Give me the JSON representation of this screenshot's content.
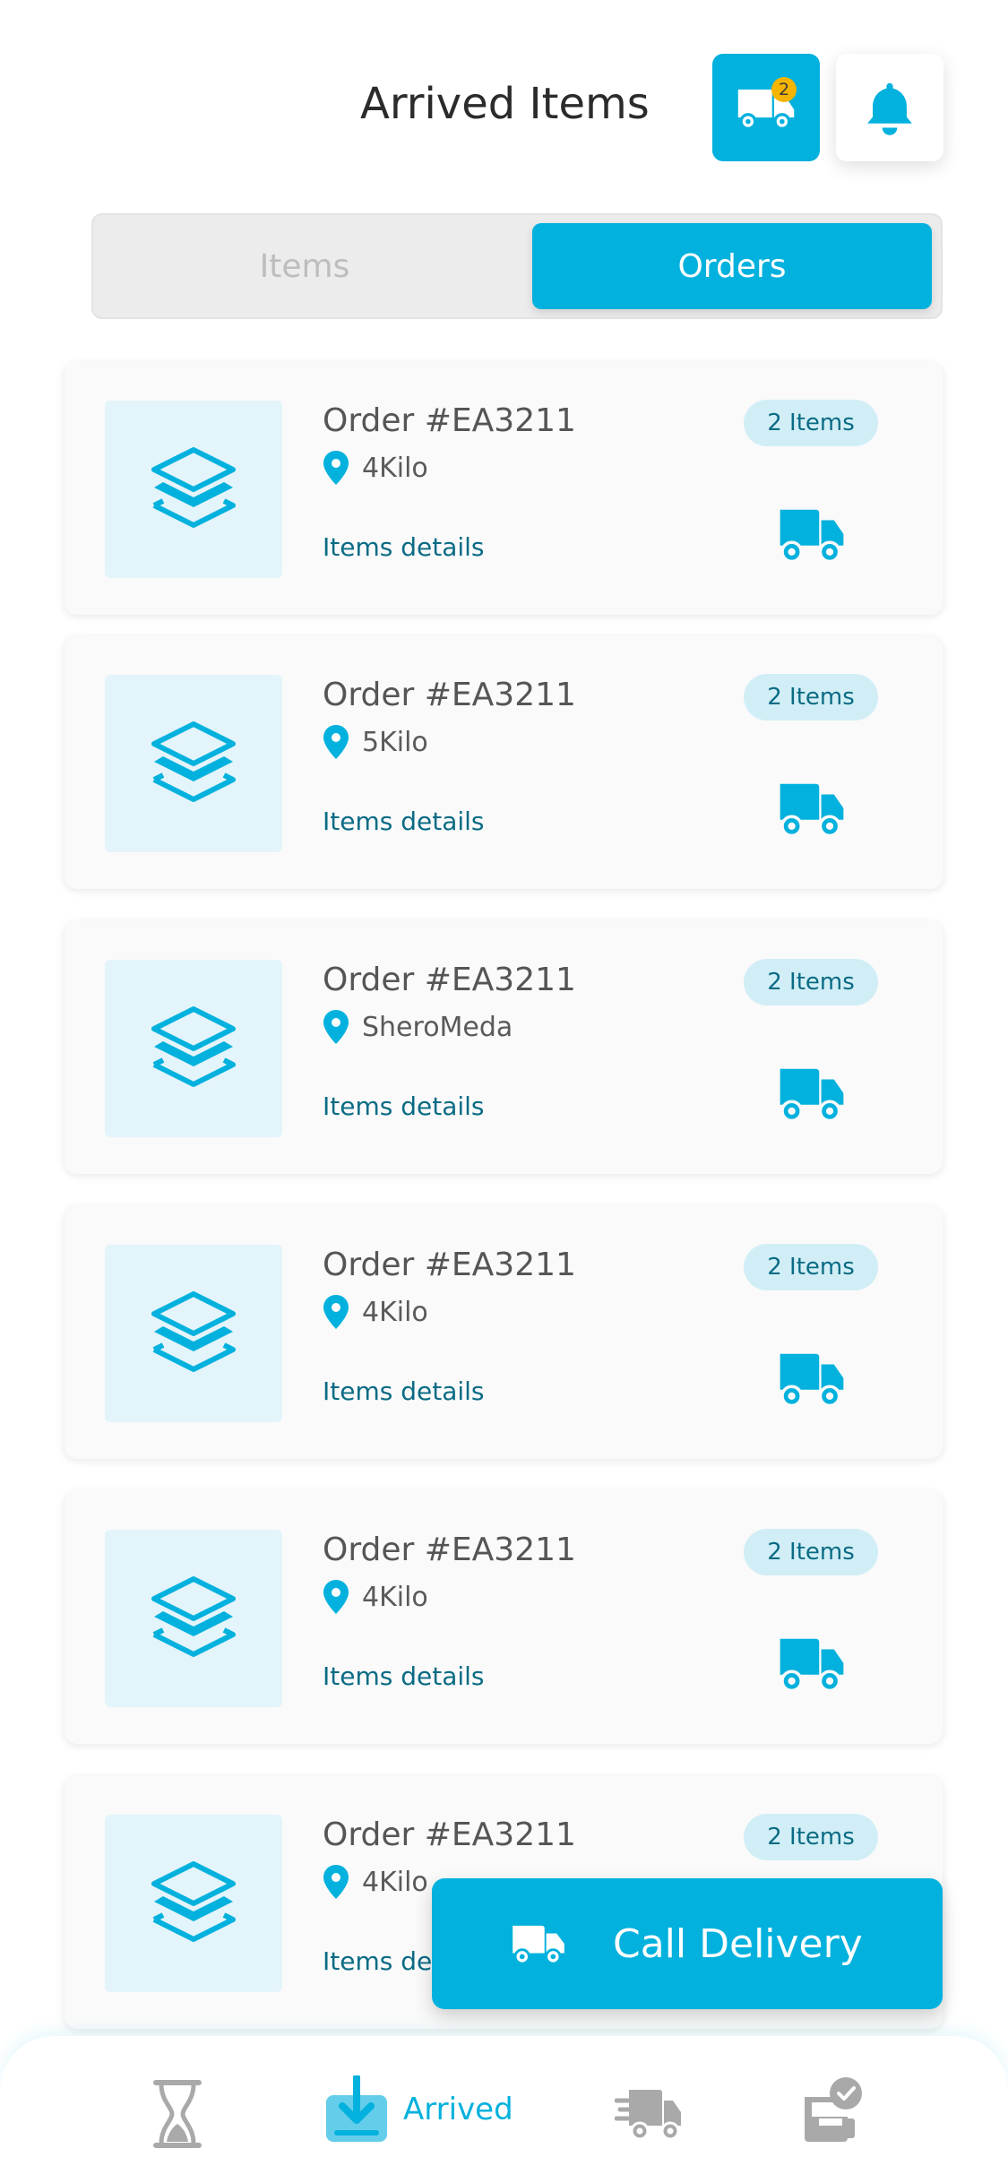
{
  "header": {
    "title": "Arrived Items",
    "truck_badge": "2",
    "truck_icon": "truck-icon",
    "bell_icon": "bell-icon"
  },
  "tabs": {
    "items_label": "Items",
    "orders_label": "Orders",
    "active": "Orders"
  },
  "orders": [
    {
      "title": "Order #EA3211",
      "location": "4Kilo",
      "count": "2 Items",
      "details": "Items details"
    },
    {
      "title": "Order #EA3211",
      "location": "5Kilo",
      "count": "2 Items",
      "details": "Items details"
    },
    {
      "title": "Order #EA3211",
      "location": "SheroMeda",
      "count": "2 Items",
      "details": "Items details"
    },
    {
      "title": "Order #EA3211",
      "location": "4Kilo",
      "count": "2 Items",
      "details": "Items details"
    },
    {
      "title": "Order #EA3211",
      "location": "4Kilo",
      "count": "2 Items",
      "details": "Items details"
    },
    {
      "title": "Order #EA3211",
      "location": "4Kilo",
      "count": "2 Items",
      "details": "Items details"
    }
  ],
  "call_delivery": {
    "label": "Call Delivery",
    "icon": "truck-icon"
  },
  "bottom_nav": {
    "items": [
      {
        "icon": "hourglass-icon",
        "label": ""
      },
      {
        "icon": "arrived-download-icon",
        "label": "Arrived",
        "active": true
      },
      {
        "icon": "fast-delivery-truck-icon",
        "label": ""
      },
      {
        "icon": "delivered-box-check-icon",
        "label": ""
      }
    ]
  },
  "colors": {
    "accent": "#02b1dd",
    "badge": "#f4b400",
    "link": "#0a6b84",
    "badge_bg": "#d1eef6",
    "thumb_bg": "#e3f4fa",
    "nav_inactive": "#a9a9a9"
  }
}
